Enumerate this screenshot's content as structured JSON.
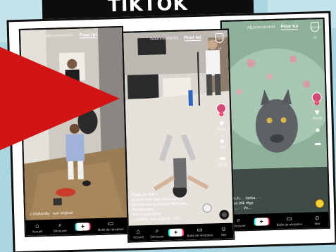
{
  "header": {
    "title": "TIKTOK"
  },
  "tiktok_ui": {
    "tab_following": "Abonnements",
    "tab_for_you": "Pour toi",
    "badge": "COVID-19",
    "nav": [
      {
        "label": "Accueil",
        "glyph": "⌂",
        "icon": "home-icon"
      },
      {
        "label": "Découvrir",
        "glyph": "⌕",
        "icon": "search-icon"
      },
      {
        "label": "",
        "glyph": "+",
        "icon": "create-icon"
      },
      {
        "label": "Boîte de réception",
        "glyph": "▭",
        "icon": "inbox-icon"
      },
      {
        "label": "Moi",
        "glyph": "☺",
        "icon": "profile-icon"
      }
    ]
  },
  "phones": {
    "left": {
      "music": "♫ snafamily · son original ·"
    },
    "center": {
      "caption_lines": [
        "Plaps en dédi ✓",
        "#paratt #fyp #pof #foryoupage",
        "#tiktokencasa #ceinpt #tiktofalbe",
        "#foryoupage"
      ],
      "translate": "Voir la traduction",
      "music": "♫ s.elliot · son original · VKT",
      "likes": "32,1k",
      "comments": "9,8k",
      "shares": "62,3k"
    },
    "right": {
      "likes": "391,0k",
      "caption_lines": [
        "@c.h... · lanka... ·",
        "#ton #tik #fyp"
      ],
      "music": "♫ ... ·  ·  Vo..."
    }
  },
  "colors": {
    "arrow": "#d21414",
    "background": "#a9d6e0",
    "accent_pink": "#fe2c55",
    "accent_cyan": "#25f4ee"
  }
}
